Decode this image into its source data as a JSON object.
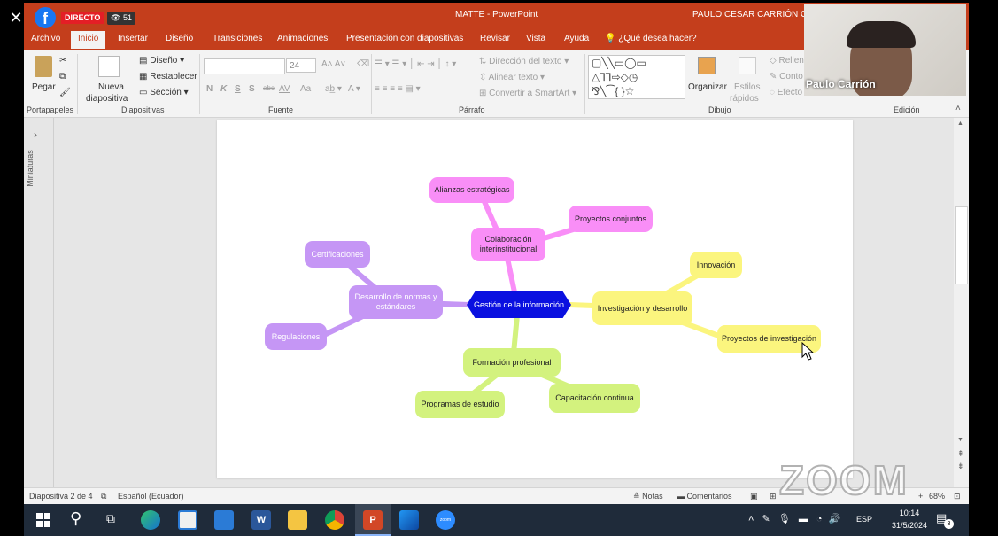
{
  "app": {
    "document_name": "MATTE",
    "app_name": "PowerPoint",
    "title_sep": "-",
    "user_name": "PAULO CESAR CARRIÓN GU"
  },
  "live": {
    "badge": "DIRECTO",
    "viewers": "51"
  },
  "tabs": [
    "Archivo",
    "Inicio",
    "Insertar",
    "Diseño",
    "Transiciones",
    "Animaciones",
    "Presentación con diapositivas",
    "Revisar",
    "Vista",
    "Ayuda"
  ],
  "tell_me": "¿Qué desea hacer?",
  "ribbon": {
    "paste": "Pegar",
    "new_slide_1": "Nueva",
    "new_slide_2": "diapositiva",
    "layout": "Diseño",
    "reset": "Restablecer",
    "section": "Sección",
    "font_size": "24",
    "bold": "N",
    "italic": "K",
    "underline": "S",
    "strike": "S",
    "char_spacing": "AV",
    "change_case": "Aa",
    "text_direction": "Dirección del texto",
    "align_text": "Alinear texto",
    "convert_smartart": "Convertir a SmartArt",
    "arrange": "Organizar",
    "quick_styles_1": "Estilos",
    "quick_styles_2": "rápidos",
    "fill": "Rellen",
    "outline": "Conto",
    "effects": "Efecto",
    "groups": {
      "clipboard": "Portapapeles",
      "slides": "Diapositivas",
      "font": "Fuente",
      "paragraph": "Párrafo",
      "drawing": "Dibujo",
      "editing": "Edición"
    }
  },
  "sidebar": {
    "thumbnails": "Miniaturas"
  },
  "mindmap": {
    "center": "Gestión de la información",
    "alianzas": "Alianzas estratégicas",
    "proyectos_conjuntos": "Proyectos conjuntos",
    "colaboracion": "Colaboración interinstitucional",
    "certificaciones": "Certificaciones",
    "normas": "Desarrollo de normas y estándares",
    "regulaciones": "Regulaciones",
    "innovacion": "Innovación",
    "investigacion": "Investigación y desarrollo",
    "proyectos_investigacion": "Proyectos de investigación",
    "formacion": "Formación profesional",
    "programas": "Programas de estudio",
    "capacitacion": "Capacitación continua"
  },
  "status": {
    "slide_info": "Diapositiva 2 de 4",
    "language": "Español (Ecuador)",
    "notes": "Notas",
    "comments": "Comentarios",
    "zoom": "68%"
  },
  "webcam": {
    "name": "Paulo Carrión"
  },
  "watermark": "ZOOM",
  "taskbar": {
    "lang": "ESP",
    "time": "10:14",
    "date": "31/5/2024",
    "notif_count": "3",
    "word_letter": "W",
    "ppt_letter": "P",
    "zoom_label": "zoom"
  },
  "colors": {
    "ppt_accent": "#c43e1c",
    "pink": "#f98ef7",
    "purple": "#c596f5",
    "yellow": "#fbf57e",
    "green": "#d3f27e",
    "center": "#0a10e0"
  }
}
